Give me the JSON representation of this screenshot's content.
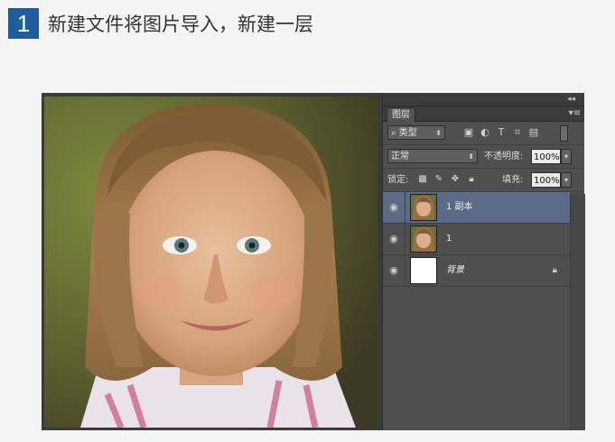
{
  "step": {
    "number": "1",
    "title": "新建文件将图片导入，新建一层"
  },
  "colors": {
    "badge": "#1e5d99",
    "selected_layer": "#5b6a86"
  },
  "panel": {
    "collapse_icon": "◂◂",
    "tab_label": "图层",
    "menu_icon": "▾≡",
    "filter_kind": "类型",
    "filter_search_icon": "⌕",
    "filter_icons": [
      "image-filter-icon",
      "adjustment-filter-icon",
      "type-filter-icon",
      "shape-filter-icon",
      "smart-object-filter-icon"
    ],
    "blend_mode": "正常",
    "opacity_label": "不透明度:",
    "opacity_value": "100%",
    "lock_label": "锁定:",
    "fill_label": "填充:",
    "fill_value": "100%"
  },
  "layers": [
    {
      "name": "1 副本",
      "selected": true,
      "thumb": "photo"
    },
    {
      "name": "1",
      "selected": false,
      "thumb": "photo"
    },
    {
      "name": "背景",
      "selected": false,
      "thumb": "white",
      "locked": true
    }
  ]
}
